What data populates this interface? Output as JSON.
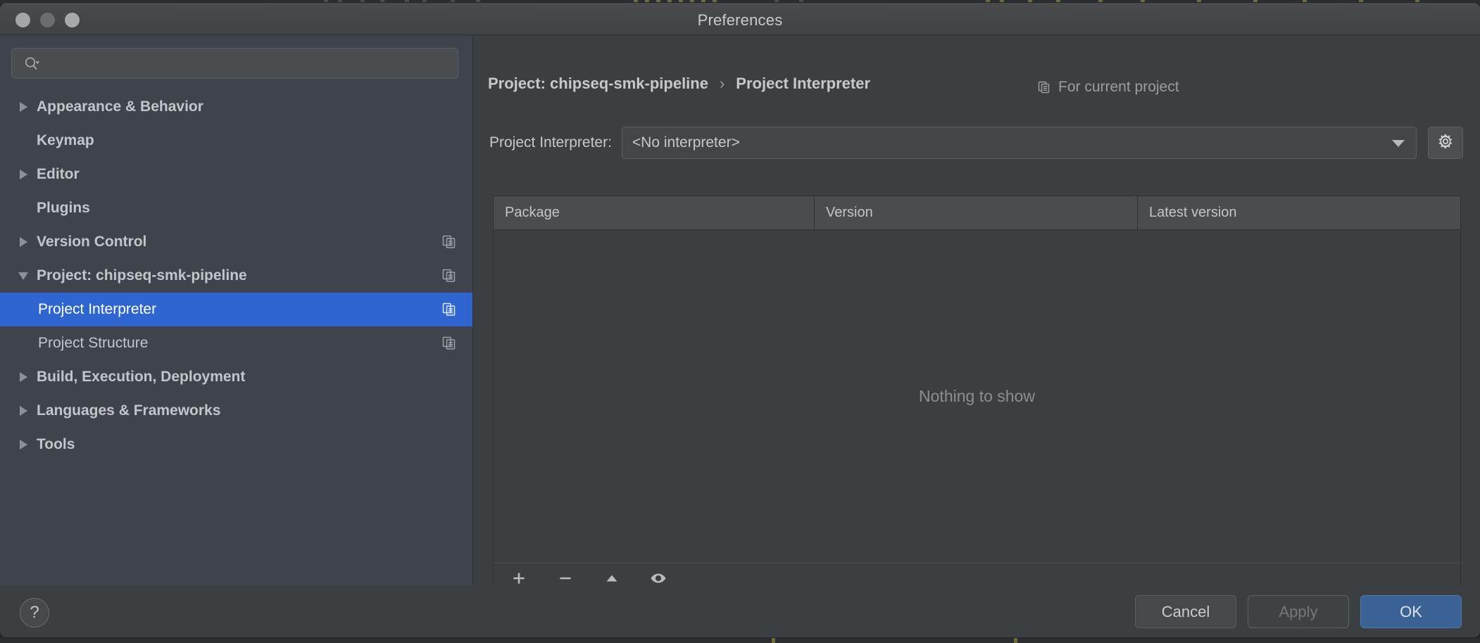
{
  "window": {
    "title": "Preferences",
    "traffic_lights": [
      "close-button",
      "minimize-button",
      "zoom-button"
    ]
  },
  "sidebar": {
    "search": {
      "value": "",
      "placeholder": "",
      "icon": "search-icon"
    },
    "items": [
      {
        "label": "Appearance & Behavior",
        "arrow": "right",
        "level": 1,
        "selected": false,
        "copy_icon": false
      },
      {
        "label": "Keymap",
        "arrow": "none",
        "level": 1,
        "selected": false,
        "copy_icon": false
      },
      {
        "label": "Editor",
        "arrow": "right",
        "level": 1,
        "selected": false,
        "copy_icon": false
      },
      {
        "label": "Plugins",
        "arrow": "none",
        "level": 1,
        "selected": false,
        "copy_icon": false
      },
      {
        "label": "Version Control",
        "arrow": "right",
        "level": 1,
        "selected": false,
        "copy_icon": true
      },
      {
        "label": "Project: chipseq-smk-pipeline",
        "arrow": "down",
        "level": 1,
        "selected": false,
        "copy_icon": true
      },
      {
        "label": "Project Interpreter",
        "arrow": "none",
        "level": 2,
        "selected": true,
        "copy_icon": true
      },
      {
        "label": "Project Structure",
        "arrow": "none",
        "level": 2,
        "selected": false,
        "copy_icon": true
      },
      {
        "label": "Build, Execution, Deployment",
        "arrow": "right",
        "level": 1,
        "selected": false,
        "copy_icon": false
      },
      {
        "label": "Languages & Frameworks",
        "arrow": "right",
        "level": 1,
        "selected": false,
        "copy_icon": false
      },
      {
        "label": "Tools",
        "arrow": "right",
        "level": 1,
        "selected": false,
        "copy_icon": false
      }
    ]
  },
  "main": {
    "breadcrumb": {
      "root": "Project: chipseq-smk-pipeline",
      "separator": "›",
      "leaf": "Project Interpreter"
    },
    "scope_hint": {
      "label": "For current project",
      "icon": "copy-icon"
    },
    "interpreter": {
      "label": "Project Interpreter:",
      "value": "<No interpreter>",
      "dropdown_icon": "chevron-down-icon",
      "settings_icon": "gear-icon"
    },
    "packages_table": {
      "columns": [
        "Package",
        "Version",
        "Latest version"
      ],
      "rows": [],
      "empty_message": "Nothing to show",
      "toolbar": [
        {
          "name": "add-package-button",
          "icon": "plus-icon"
        },
        {
          "name": "remove-package-button",
          "icon": "minus-icon"
        },
        {
          "name": "upgrade-package-button",
          "icon": "triangle-up-icon"
        },
        {
          "name": "show-early-releases-button",
          "icon": "eye-icon"
        }
      ]
    }
  },
  "footer": {
    "help_label": "?",
    "cancel_label": "Cancel",
    "apply_label": "Apply",
    "ok_label": "OK"
  },
  "colors": {
    "sidebar_bg": "#3F434C",
    "panel_bg": "#3C3F41",
    "selection_blue": "#2F65D0",
    "primary_button": "#3B6294",
    "text": "#C3C6C9",
    "muted_text": "#8C8F91"
  }
}
